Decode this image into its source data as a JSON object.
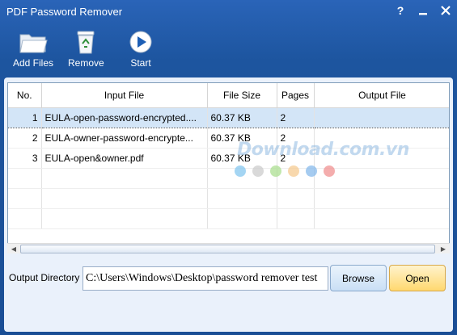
{
  "window": {
    "title": "PDF Password Remover",
    "help_label": "?"
  },
  "toolbar": {
    "add_files": "Add Files",
    "remove": "Remove",
    "start": "Start"
  },
  "grid": {
    "columns": [
      "No.",
      "Input File",
      "File Size",
      "Pages",
      "Output File"
    ],
    "rows": [
      {
        "no": "1",
        "input": "EULA-open-password-encrypted....",
        "size": "60.37 KB",
        "pages": "2",
        "output": ""
      },
      {
        "no": "2",
        "input": "EULA-owner-password-encrypte...",
        "size": "60.37 KB",
        "pages": "2",
        "output": ""
      },
      {
        "no": "3",
        "input": "EULA-open&owner.pdf",
        "size": "60.37 KB",
        "pages": "2",
        "output": ""
      }
    ],
    "selected_row": 0
  },
  "output": {
    "label": "Output Directory",
    "path": "C:\\Users\\Windows\\Desktop\\password remover test",
    "browse": "Browse",
    "open": "Open"
  },
  "watermark": {
    "text": "Download.com.vn",
    "dot_colors": [
      "#7ec3ee",
      "#c9c9c9",
      "#a6dd8a",
      "#f5c88a",
      "#7fb5ea",
      "#f08a8a"
    ]
  },
  "colors": {
    "titlebar": "#1d559f",
    "selection": "#d3e5f7",
    "open_button": "#ffd86f",
    "browse_button": "#c9dff5"
  }
}
